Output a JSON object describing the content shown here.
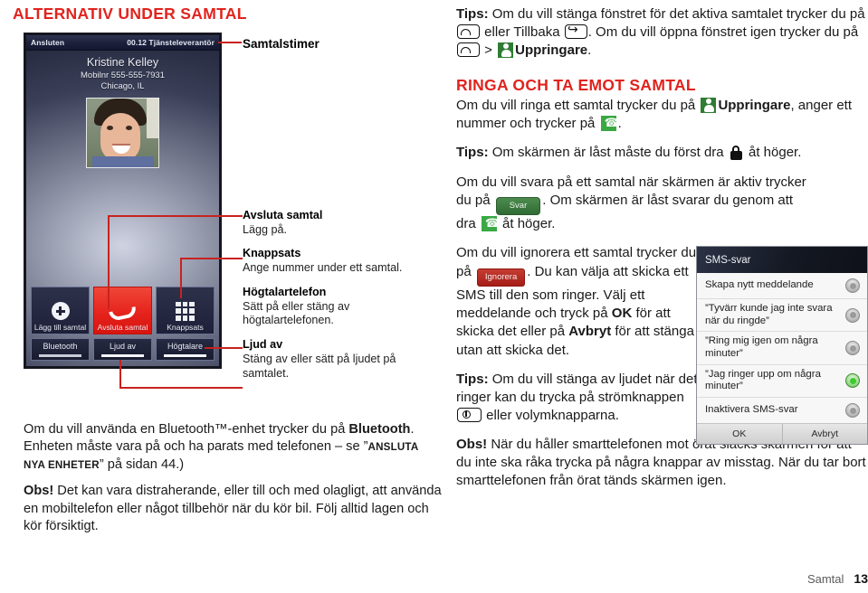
{
  "left": {
    "section_heading": "ALTERNATIV UNDER SAMTAL",
    "phone": {
      "status_left": "Ansluten",
      "status_right": "00.12 Tjänsteleverantör",
      "callee_name": "Kristine Kelley",
      "callee_number": "Mobilnr 555-555-7931",
      "callee_city": "Chicago, IL",
      "buttons_row1": [
        "Lägg till samtal",
        "Avsluta samtal",
        "Knappsats"
      ],
      "buttons_row2": [
        "Bluetooth",
        "Ljud av",
        "Högtalare"
      ]
    },
    "callout_timer": "Samtalstimer",
    "callouts": [
      {
        "title": "Avsluta samtal",
        "body": "Lägg på."
      },
      {
        "title": "Knappsats",
        "body": "Ange nummer under ett samtal."
      },
      {
        "title": "Högtalartelefon",
        "body": "Sätt på eller stäng av högtalartelefonen."
      },
      {
        "title": "Ljud av",
        "body": "Stäng av eller sätt på ljudet på samtalet."
      }
    ],
    "para_bluetooth_1": "Om du vill använda en Bluetooth™-enhet trycker du på ",
    "para_bluetooth_bold": "Bluetooth",
    "para_bluetooth_2": ". Enheten måste vara på och ha parats med telefonen – se ”",
    "para_bluetooth_sc": "ANSLUTA NYA ENHETER",
    "para_bluetooth_3": "” på sidan 44.)",
    "para_obs_bold": "Obs!",
    "para_obs": " Det kan vara distraherande, eller till och med olagligt, att använda en mobiltelefon eller något tillbehör när du kör bil. Följ alltid lagen och kör försiktigt."
  },
  "right": {
    "tips1_bold": "Tips:",
    "tips1_a": " Om du vill stänga fönstret för det aktiva samtalet trycker du på ",
    "tips1_b": " eller Tillbaka ",
    "tips1_c": ". Om du vill öppna fönstret igen trycker du på ",
    "tips1_d": " > ",
    "tips1_upp": "Uppringare",
    "tips1_end": ".",
    "heading": "RINGA OCH TA EMOT SAMTAL",
    "p2_a": "Om du vill ringa ett samtal trycker du på ",
    "p2_upp": "Uppringare",
    "p2_b": ", anger ett nummer och trycker på ",
    "p2_end": ".",
    "tips2_bold": "Tips:",
    "tips2_a": " Om skärmen är låst måste du först dra ",
    "tips2_b": " åt höger.",
    "p3_a": "Om du vill svara på ett samtal när skärmen är aktiv trycker du på ",
    "p3_svar": "Svar",
    "p3_b": ". Om skärmen är låst svarar du genom att dra ",
    "p3_c": " åt höger.",
    "p4_a": "Om du vill ignorera ett samtal trycker du på ",
    "p4_ignorera": "Ignorera",
    "p4_b": ". Du kan välja att skicka ett SMS till den som ringer. Välj ett meddelande och tryck på ",
    "p4_ok": "OK",
    "p4_c": " för att skicka det eller på ",
    "p4_avbryt": "Avbryt",
    "p4_d": " för att stänga utan att skicka det.",
    "tips3_bold": "Tips:",
    "tips3_a": " Om du vill stänga av ljudet när det ringer kan du trycka på strömknappen ",
    "tips3_b": " eller volymknapparna.",
    "obs_bold": "Obs!",
    "obs_text": " När du håller smarttelefonen mot örat släcks skärmen för att du inte ska råka trycka på några knappar av misstag. När du tar bort smarttelefonen från örat tänds skärmen igen.",
    "sms_dialog": {
      "title": "SMS-svar",
      "items": [
        {
          "label": "Skapa nytt meddelande",
          "selected": false
        },
        {
          "label": "”Tyvärr kunde jag inte svara när du ringde”",
          "selected": false
        },
        {
          "label": "”Ring mig igen om några minuter”",
          "selected": false
        },
        {
          "label": "”Jag ringer upp om några minuter”",
          "selected": true
        },
        {
          "label": "Inaktivera SMS-svar",
          "selected": false
        }
      ],
      "ok": "OK",
      "cancel": "Avbryt"
    },
    "footer_chapter": "Samtal",
    "footer_page": "13"
  },
  "colors": {
    "brand_red": "#e1231d",
    "callout_red": "#c8221f",
    "green_accent": "#3aa844",
    "phone_dark": "#1b1d2c"
  }
}
